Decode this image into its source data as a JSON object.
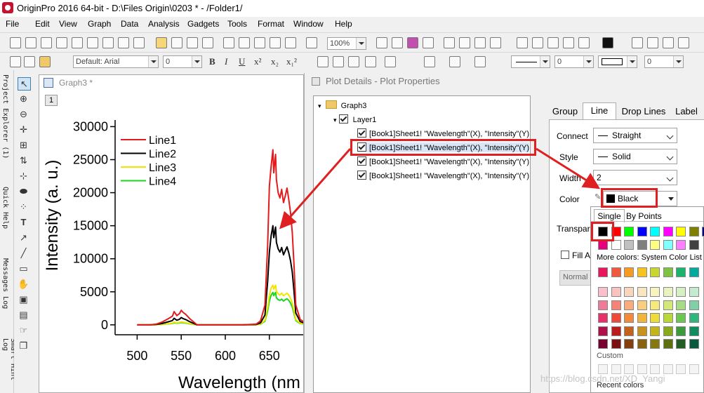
{
  "window": {
    "title": "OriginPro 2016 64-bit - D:\\Files Origin\\0203 * - /Folder1/"
  },
  "menu": [
    "File",
    "Edit",
    "View",
    "Graph",
    "Data",
    "Analysis",
    "Gadgets",
    "Tools",
    "Format",
    "Window",
    "Help"
  ],
  "toolbar": {
    "zoom": "100%",
    "font": "Default: Arial",
    "font_size": "0",
    "size2": "0",
    "size3": "0",
    "format_buttons": [
      "B",
      "I",
      "U",
      "x²",
      "x₂",
      "x₁²"
    ]
  },
  "side_panels": [
    "Project Explorer (1)",
    "Quick Help",
    "Messages Log",
    "Smart Hint Log"
  ],
  "graph": {
    "window_title": "Graph3 *",
    "layer_tab": "1",
    "chart_data": {
      "type": "line",
      "xlabel": "Wavelength (nm",
      "ylabel": "Intensity (a. u.)",
      "xlim": [
        475,
        690
      ],
      "ylim": [
        -1500,
        31000
      ],
      "xticks": [
        500,
        550,
        600,
        650
      ],
      "yticks": [
        0,
        5000,
        10000,
        15000,
        20000,
        25000,
        30000
      ],
      "series": [
        {
          "name": "Line1",
          "color": "#e41a1c",
          "x": [
            500,
            515,
            522,
            528,
            535,
            540,
            542,
            545,
            548,
            550,
            552,
            555,
            560,
            568,
            575,
            590,
            605,
            620,
            635,
            640,
            645,
            648,
            650,
            652,
            654,
            655,
            656,
            657,
            658,
            660,
            662,
            664,
            666,
            668,
            670,
            672,
            674,
            676,
            678,
            680,
            685,
            690
          ],
          "y": [
            0,
            0,
            120,
            400,
            900,
            1300,
            2000,
            1400,
            1700,
            2200,
            1900,
            1600,
            900,
            0,
            0,
            0,
            0,
            0,
            100,
            600,
            3000,
            12000,
            21000,
            24000,
            26500,
            23000,
            24500,
            25800,
            22000,
            20000,
            19200,
            20500,
            18500,
            19500,
            20700,
            19000,
            17000,
            14000,
            9000,
            3000,
            800,
            400
          ]
        },
        {
          "name": "Line2",
          "color": "#000000",
          "x": [
            500,
            515,
            522,
            528,
            535,
            540,
            542,
            545,
            548,
            550,
            552,
            555,
            560,
            568,
            575,
            590,
            605,
            620,
            635,
            640,
            645,
            648,
            650,
            652,
            654,
            655,
            656,
            657,
            658,
            660,
            662,
            664,
            666,
            668,
            670,
            672,
            674,
            676,
            678,
            680,
            685,
            690
          ],
          "y": [
            0,
            0,
            60,
            200,
            450,
            650,
            1000,
            700,
            850,
            1100,
            950,
            800,
            450,
            0,
            0,
            0,
            0,
            0,
            50,
            300,
            1500,
            6500,
            11000,
            13500,
            15000,
            13200,
            14000,
            14800,
            12500,
            11500,
            11000,
            11700,
            10600,
            11200,
            11800,
            10900,
            9700,
            8000,
            5000,
            1800,
            500,
            250
          ]
        },
        {
          "name": "Line3",
          "color": "#f2e600",
          "x": [
            500,
            515,
            522,
            528,
            535,
            540,
            542,
            545,
            548,
            550,
            552,
            555,
            560,
            568,
            575,
            590,
            605,
            620,
            635,
            640,
            645,
            648,
            650,
            652,
            654,
            655,
            656,
            657,
            658,
            660,
            662,
            664,
            666,
            668,
            670,
            672,
            674,
            676,
            678,
            680,
            685,
            690
          ],
          "y": [
            0,
            0,
            30,
            80,
            180,
            250,
            400,
            300,
            350,
            450,
            400,
            330,
            180,
            0,
            0,
            0,
            0,
            0,
            20,
            120,
            700,
            2600,
            4500,
            5600,
            6000,
            5400,
            5700,
            6000,
            5100,
            4700,
            4500,
            4800,
            4400,
            4600,
            4800,
            4500,
            4000,
            3300,
            2100,
            800,
            250,
            120
          ]
        },
        {
          "name": "Line4",
          "color": "#1ed41e",
          "x": [
            500,
            515,
            522,
            528,
            535,
            540,
            542,
            545,
            548,
            550,
            552,
            555,
            560,
            568,
            575,
            590,
            605,
            620,
            635,
            640,
            645,
            648,
            650,
            652,
            654,
            655,
            656,
            657,
            658,
            660,
            662,
            664,
            666,
            668,
            670,
            672,
            674,
            676,
            678,
            680,
            685,
            690
          ],
          "y": [
            0,
            0,
            25,
            70,
            150,
            200,
            320,
            240,
            280,
            360,
            320,
            260,
            150,
            0,
            0,
            0,
            0,
            0,
            15,
            100,
            550,
            2100,
            3600,
            4500,
            4900,
            4400,
            4700,
            4900,
            4100,
            3800,
            3700,
            3900,
            3600,
            3800,
            3950,
            3700,
            3300,
            2700,
            1700,
            650,
            200,
            100
          ]
        }
      ]
    }
  },
  "dialog": {
    "title": "Plot Details - Plot Properties",
    "tree": {
      "root": "Graph3",
      "layer": "Layer1",
      "plots": [
        "[Book1]Sheet1! \"Wavelength\"(X), \"Intensity\"(Y)",
        "[Book1]Sheet1! \"Wavelength\"(X), \"Intensity\"(Y)",
        "[Book1]Sheet1! \"Wavelength\"(X), \"Intensity\"(Y)",
        "[Book1]Sheet1! \"Wavelength\"(X), \"Intensity\"(Y)"
      ]
    },
    "tabs": [
      "Group",
      "Line",
      "Drop Lines",
      "Label"
    ],
    "labels": {
      "connect": "Connect",
      "style": "Style",
      "width": "Width",
      "color": "Color",
      "transparency": "Transpare",
      "fill": "Fill Are",
      "normal": "Normal"
    },
    "values": {
      "connect": "Straight",
      "style": "Solid",
      "width": "2",
      "color": "Black"
    }
  },
  "color_popup": {
    "tabs": [
      "Single",
      "By Points"
    ],
    "more_colors": "More colors: System Color List",
    "custom": "Custom",
    "recent": "Recent colors",
    "row1": [
      "#000000",
      "#ff0000",
      "#00ff00",
      "#0000ff",
      "#00ffff",
      "#ff00ff",
      "#ffff00",
      "#808000",
      "#000080"
    ],
    "row2": [
      "#e6007e",
      "#ffffff",
      "#c0c0c0",
      "#808080",
      "#ffff80",
      "#80ffff",
      "#ff80ff",
      "#404040"
    ],
    "system_row": [
      "#e8175d",
      "#f05a3c",
      "#f59a23",
      "#f7c31e",
      "#c8d62e",
      "#7dc242",
      "#1bb46f",
      "#00aa9e"
    ],
    "grid": [
      [
        "#f9c0cb",
        "#f9c4c0",
        "#f9d7bf",
        "#f9e6c0",
        "#f9f3c0",
        "#e9f3c0",
        "#d6efc3",
        "#c4ebd0"
      ],
      [
        "#f07a99",
        "#f58378",
        "#f8ad7b",
        "#f9cf7d",
        "#f6ea7a",
        "#d2e87a",
        "#a6dc86",
        "#7fd1a5"
      ],
      [
        "#e8306a",
        "#ee4a3a",
        "#f18b3b",
        "#f2b53a",
        "#f0dc38",
        "#b8d83a",
        "#6bc654",
        "#2fb67a"
      ],
      [
        "#b0104a",
        "#b81c1c",
        "#c2621c",
        "#c8921c",
        "#c4b41c",
        "#8aa81c",
        "#3d9a3c",
        "#0f8d5e"
      ],
      [
        "#780030",
        "#7a1010",
        "#83400f",
        "#87620f",
        "#85780f",
        "#5c700f",
        "#235f24",
        "#075a3c"
      ]
    ]
  },
  "watermark": "https://blog.csdn.net/XD_Yangi"
}
